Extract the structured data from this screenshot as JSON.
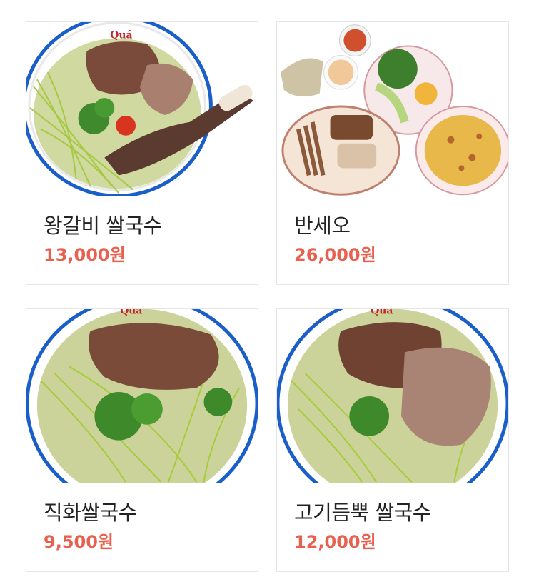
{
  "menu": {
    "items": [
      {
        "name": "왕갈비 쌀국수",
        "price": "13,000원",
        "image_icon": "beef-rib-pho-photo",
        "bowl_brand": "Quá"
      },
      {
        "name": "반세오",
        "price": "26,000원",
        "image_icon": "banh-xeo-platter-photo"
      },
      {
        "name": "직화쌀국수",
        "price": "9,500원",
        "image_icon": "grilled-beef-pho-photo",
        "bowl_brand": "Quá"
      },
      {
        "name": "고기듬뿍 쌀국수",
        "price": "12,000원",
        "image_icon": "extra-meat-pho-photo",
        "bowl_brand": "Quá"
      }
    ]
  },
  "colors": {
    "price": "#e8614f",
    "name": "#222222",
    "card_border": "#e6e6e6",
    "bowl_rim": "#1a5fc9"
  }
}
